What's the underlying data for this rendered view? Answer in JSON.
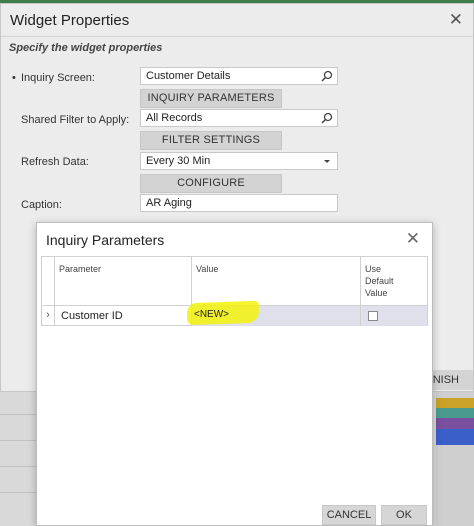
{
  "widget_properties": {
    "title": "Widget Properties",
    "subtitle": "Specify the widget properties",
    "required_marker": "•",
    "fields": {
      "inquiry_screen": {
        "label": "Inquiry Screen:",
        "value": "Customer Details",
        "button": "INQUIRY PARAMETERS"
      },
      "shared_filter": {
        "label": "Shared Filter to Apply:",
        "value": "All Records",
        "button": "FILTER SETTINGS"
      },
      "refresh_data": {
        "label": "Refresh Data:",
        "value": "Every 30 Min",
        "button": "CONFIGURE"
      },
      "caption": {
        "label": "Caption:",
        "value": "AR Aging"
      }
    },
    "finish_button_visible": "NISH"
  },
  "inquiry_parameters": {
    "title": "Inquiry Parameters",
    "columns": {
      "parameter": "Parameter",
      "value": "Value",
      "use_default_line1": "Use",
      "use_default_line2": "Default",
      "use_default_line3": "Value"
    },
    "rows": [
      {
        "parameter": "Customer ID",
        "value": "<NEW>",
        "use_default": false
      }
    ],
    "buttons": {
      "cancel": "CANCEL",
      "ok": "OK"
    }
  },
  "colors": {
    "highlight": "#f4f20a",
    "selected_cell": "#dfe0ec",
    "chart_bars": [
      "#c9a227",
      "#4a9b8e",
      "#7a4fa0",
      "#3a5fc8"
    ]
  }
}
